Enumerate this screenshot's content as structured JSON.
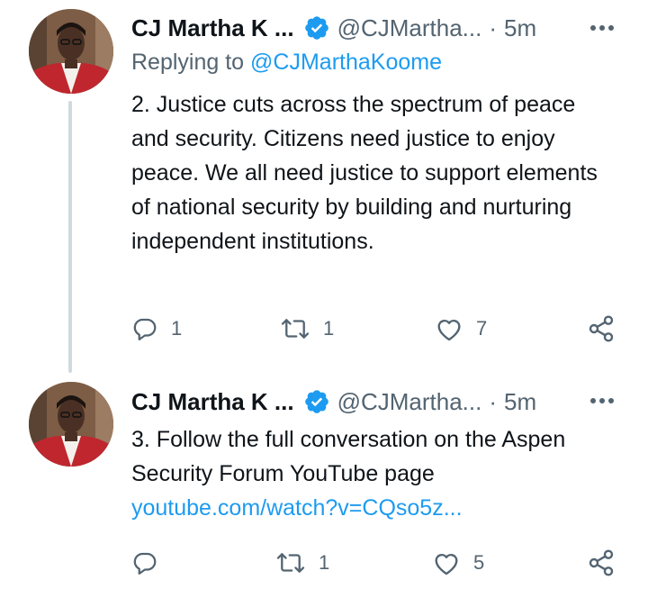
{
  "colors": {
    "text": "#0f1419",
    "secondary": "#536471",
    "link": "#1d9bf0",
    "verified": "#1d9bf0",
    "thread_line": "#cfd9de"
  },
  "tweets": [
    {
      "author_name": "CJ Martha K ...",
      "author_handle": "@CJMartha...",
      "separator": "·",
      "time": "5m",
      "reply_prefix": "Replying to ",
      "reply_to": "@CJMarthaKoome",
      "text": "2. Justice cuts across the spectrum of peace and security.  Citizens need justice to enjoy peace.  We all need justice to support elements of national security by building and nurturing independent institutions.",
      "link": "",
      "replies": "1",
      "retweets": "1",
      "likes": "7",
      "icons": {
        "reply": "reply-icon",
        "retweet": "retweet-icon",
        "like": "heart-icon",
        "share": "share-icon",
        "more": "more-icon",
        "verified": "verified-badge-icon"
      }
    },
    {
      "author_name": "CJ Martha K ...",
      "author_handle": "@CJMartha...",
      "separator": "·",
      "time": "5m",
      "text": "3. Follow the full conversation on the Aspen Security Forum YouTube page",
      "link": "youtube.com/watch?v=CQso5z...",
      "replies": "",
      "retweets": "1",
      "likes": "5",
      "icons": {
        "reply": "reply-icon",
        "retweet": "retweet-icon",
        "like": "heart-icon",
        "share": "share-icon",
        "more": "more-icon",
        "verified": "verified-badge-icon"
      }
    }
  ]
}
